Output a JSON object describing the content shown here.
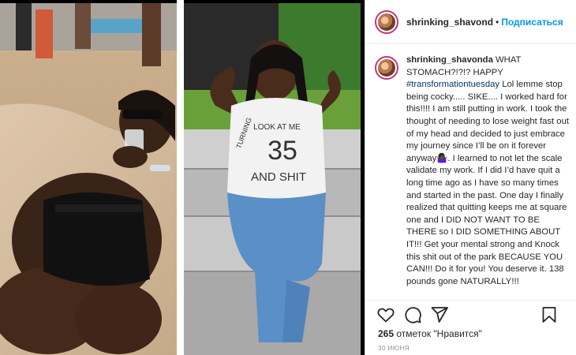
{
  "post": {
    "username": "shrinking_shavonda",
    "header_username": "shrinking_shavond",
    "separator": "•",
    "follow_label": "Подписаться",
    "caption_head": "WHAT STOMACH?!?!? HAPPY ",
    "hashtag": "#transformationtuesday",
    "caption_body": " Lol lemme stop being cocky..... SIKE.... I worked hard for this!!!! I am still putting in work. I took the thought of needing to lose weight fast out of my head and decided to just embrace my journey since I’ll be on it forever anyway🤷🏿‍♀️. I learned to not let the scale validate my work. If I did I’d have quit a long time ago as I have so many times and started in the past. One day I finally realized that quitting keeps me at square one and I DID NOT WANT TO BE THERE so I DID SOMETHING ABOUT IT!!! Get your mental strong and Knock this shit out of the park BECAUSE YOU CAN!!! Do it for you! You deserve it. 138 pounds gone NATURALLY!!!",
    "likes_count": "265",
    "likes_label": " отметок \"Нравится\"",
    "date": "30 ИЮНЯ"
  },
  "photo": {
    "shirt_text_top": "LOOK AT ME",
    "shirt_number": "35",
    "shirt_text_side": "TURNING",
    "shirt_text_bottom": "AND SHIT"
  },
  "icons": [
    "heart-icon",
    "comment-icon",
    "share-icon",
    "bookmark-icon"
  ],
  "colors": {
    "follow": "#0095f6",
    "hashtag": "#00376b",
    "text": "#262626",
    "muted": "#8e8e8e"
  }
}
